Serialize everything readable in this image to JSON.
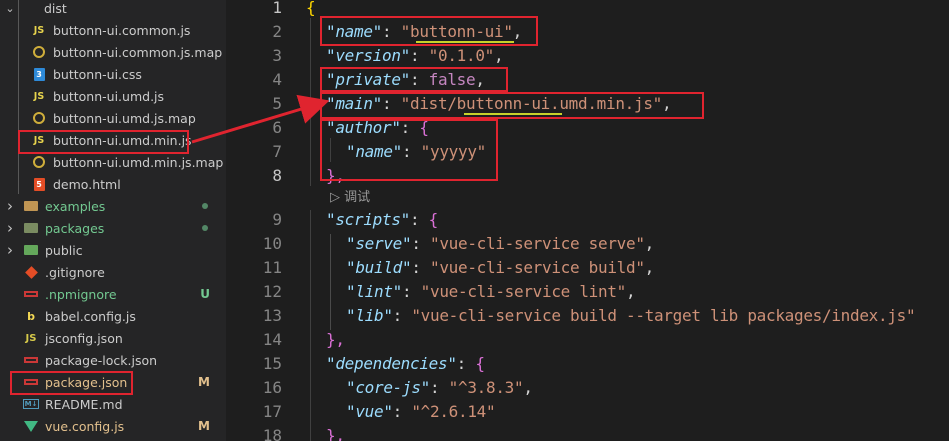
{
  "sidebar": {
    "folder_name": "dist",
    "dist_files": [
      {
        "icon": "js-icon",
        "name": "buttonn-ui.common.js"
      },
      {
        "icon": "map-icon",
        "name": "buttonn-ui.common.js.map"
      },
      {
        "icon": "css-icon",
        "name": "buttonn-ui.css"
      },
      {
        "icon": "js-icon",
        "name": "buttonn-ui.umd.js"
      },
      {
        "icon": "map-icon",
        "name": "buttonn-ui.umd.js.map"
      },
      {
        "icon": "js-icon",
        "name": "buttonn-ui.umd.min.js"
      },
      {
        "icon": "map-icon",
        "name": "buttonn-ui.umd.min.js.map"
      },
      {
        "icon": "html-icon",
        "name": "demo.html"
      }
    ],
    "root_items": [
      {
        "type": "folder",
        "name": "examples",
        "color": "#73c991",
        "status": "dot"
      },
      {
        "type": "folder",
        "name": "packages",
        "color": "#73c991",
        "status": "dot"
      },
      {
        "type": "folder",
        "name": "public",
        "color": "#cccccc",
        "status": ""
      },
      {
        "type": "file",
        "icon": "git-icon",
        "name": ".gitignore",
        "color": "#cccccc",
        "status": ""
      },
      {
        "type": "file",
        "icon": "npm-icon",
        "name": ".npmignore",
        "color": "#73c991",
        "status": "U"
      },
      {
        "type": "file",
        "icon": "babel-icon",
        "name": "babel.config.js",
        "color": "#cccccc",
        "status": ""
      },
      {
        "type": "file",
        "icon": "json-icon",
        "name": "jsconfig.json",
        "color": "#cccccc",
        "status": ""
      },
      {
        "type": "file",
        "icon": "npm-icon",
        "name": "package-lock.json",
        "color": "#cccccc",
        "status": ""
      },
      {
        "type": "file",
        "icon": "npm-icon",
        "name": "package.json",
        "color": "#e2c08d",
        "status": "M"
      },
      {
        "type": "file",
        "icon": "md-icon",
        "name": "README.md",
        "color": "#cccccc",
        "status": ""
      },
      {
        "type": "file",
        "icon": "vue-icon",
        "name": "vue.config.js",
        "color": "#e2c08d",
        "status": "M"
      }
    ]
  },
  "editor": {
    "line_numbers": [
      "1",
      "2",
      "3",
      "4",
      "5",
      "6",
      "7",
      "8",
      "9",
      "10",
      "11",
      "12",
      "13",
      "14",
      "15",
      "16",
      "17",
      "18"
    ],
    "codelens": "调试",
    "codelens_icon": "debug-run-icon",
    "lines": {
      "l1": "{",
      "l2_key": "\"name\"",
      "l2_val": "\"buttonn-ui\"",
      "l3_key": "\"version\"",
      "l3_val": "\"0.1.0\"",
      "l4_key": "\"private\"",
      "l4_val": "false",
      "l5_key": "\"main\"",
      "l5_val": "\"dist/buttonn-ui.umd.min.js\"",
      "l6_key": "\"author\"",
      "l6_val": "{",
      "l7_key": "\"name\"",
      "l7_val": "\"yyyyy\"",
      "l8": "},",
      "l9_key": "\"scripts\"",
      "l9_val": "{",
      "l10_key": "\"serve\"",
      "l10_val": "\"vue-cli-service serve\"",
      "l11_key": "\"build\"",
      "l11_val": "\"vue-cli-service build\"",
      "l12_key": "\"lint\"",
      "l12_val": "\"vue-cli-service lint\"",
      "l13_key": "\"lib\"",
      "l13_val": "\"vue-cli-service build --target lib packages/index.js\"",
      "l14": "},",
      "l15_key": "\"dependencies\"",
      "l15_val": "{",
      "l16_key": "\"core-js\"",
      "l16_val": "\"^3.8.3\"",
      "l17_key": "\"vue\"",
      "l17_val": "\"^2.6.14\"",
      "l18": "},"
    }
  },
  "colors": {
    "annotation_red": "#e0242f",
    "underline_yellow": "#c8d22a"
  }
}
